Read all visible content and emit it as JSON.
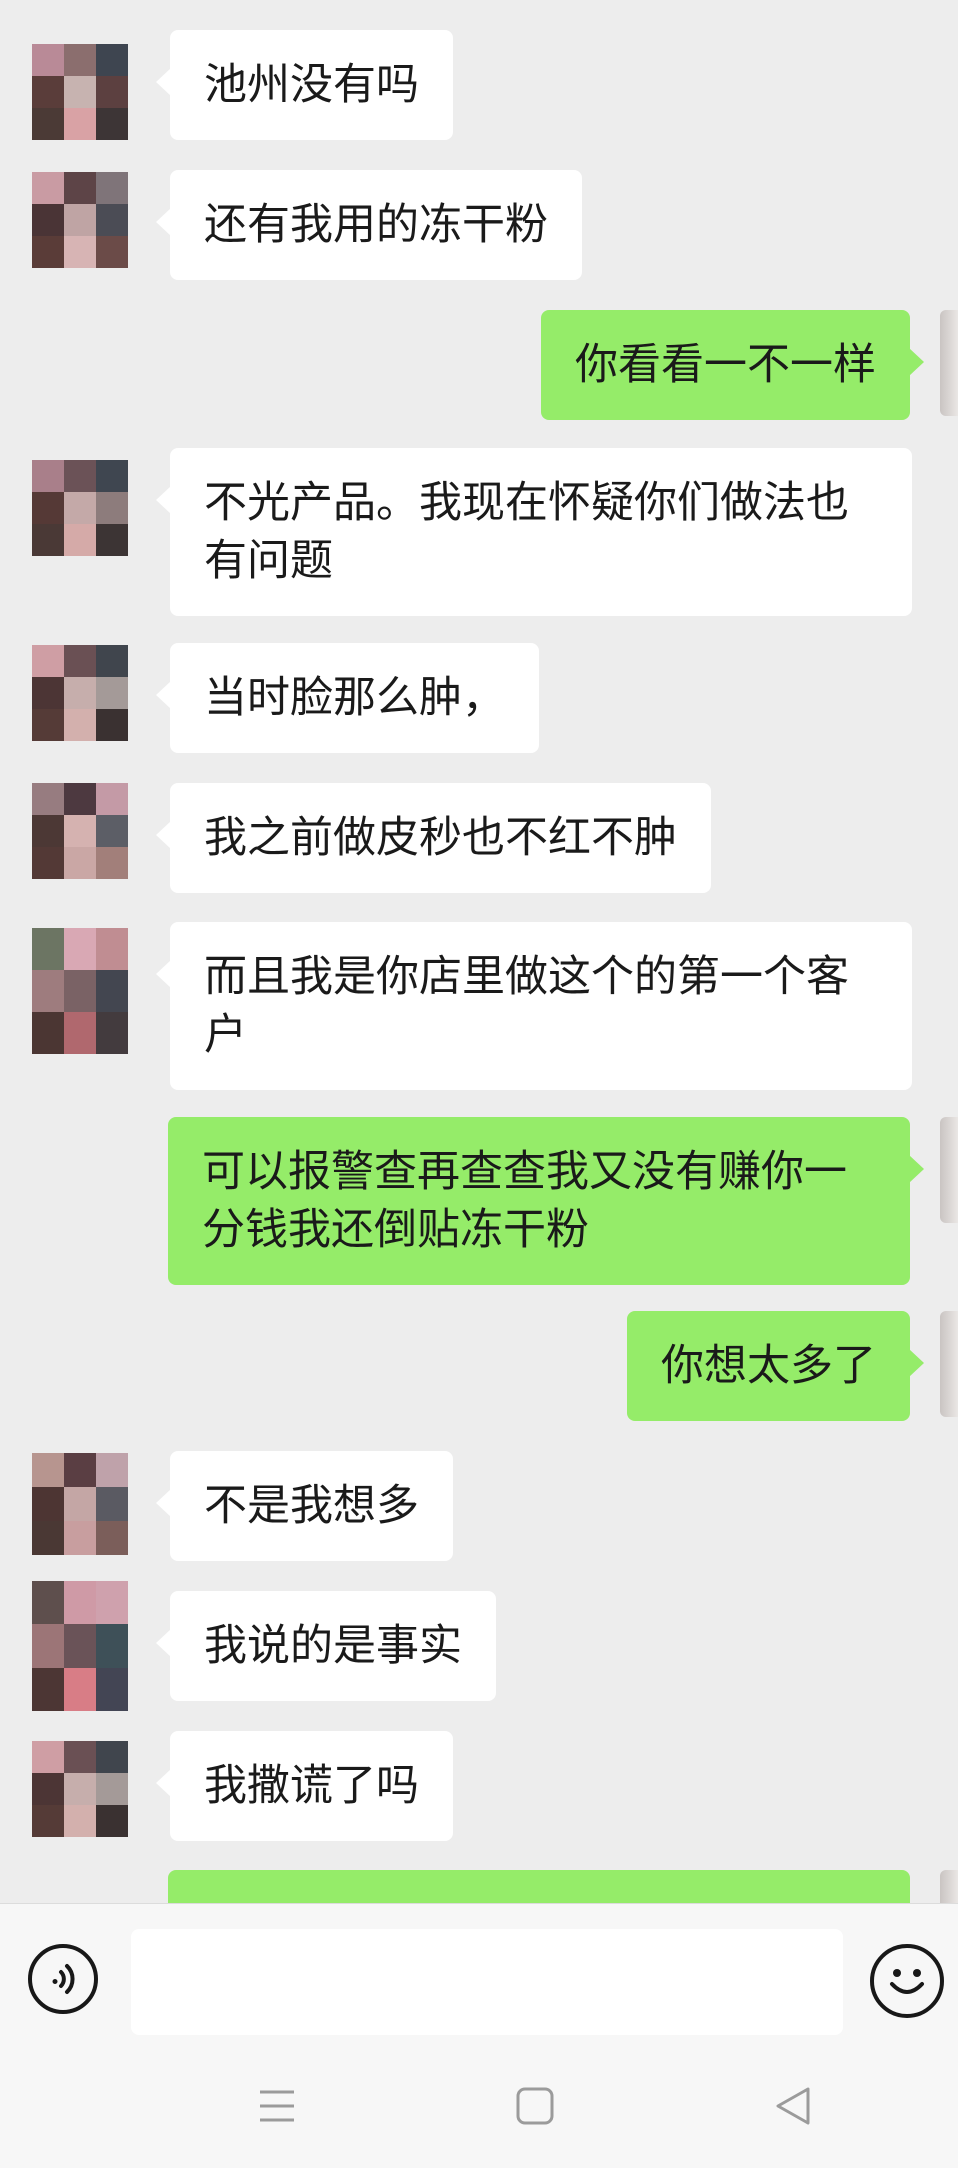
{
  "colors": {
    "chat_background": "#ededed",
    "incoming_bubble": "#ffffff",
    "outgoing_bubble": "#95ec69",
    "text": "#1a1a1a"
  },
  "messages": [
    {
      "side": "in",
      "text": "池州没有吗"
    },
    {
      "side": "in",
      "text": "还有我用的冻干粉"
    },
    {
      "side": "out",
      "text": "你看看一不一样"
    },
    {
      "side": "in",
      "text": "不光产品。我现在怀疑你们做法也有问题"
    },
    {
      "side": "in",
      "text": "当时脸那么肿，"
    },
    {
      "side": "in",
      "text": "我之前做皮秒也不红不肿"
    },
    {
      "side": "in",
      "text": "而且我是你店里做这个的第一个客户"
    },
    {
      "side": "out",
      "text": "可以报警查再查查我又没有赚你一分钱我还倒贴冻干粉"
    },
    {
      "side": "out",
      "text": "你想太多了"
    },
    {
      "side": "in",
      "text": "不是我想多"
    },
    {
      "side": "in",
      "text": "我说的是事实"
    },
    {
      "side": "in",
      "text": "我撒谎了吗"
    },
    {
      "side": "out",
      "text": ""
    }
  ],
  "input_bar": {
    "voice_icon": "voice-icon",
    "emoji_icon": "emoji-icon",
    "message_value": ""
  },
  "nav_bar": {
    "icons": [
      "menu-icon",
      "home-icon",
      "back-icon"
    ]
  }
}
